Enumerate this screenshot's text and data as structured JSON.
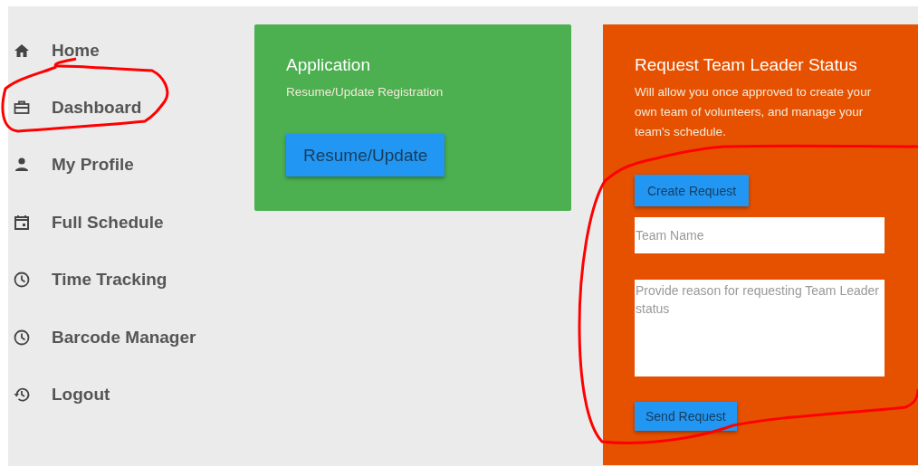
{
  "sidebar": {
    "items": [
      {
        "label": "Home",
        "kind": "home",
        "selected": false
      },
      {
        "label": "Dashboard",
        "kind": "briefcase",
        "selected": false
      },
      {
        "label": "My Profile",
        "kind": "person",
        "selected": false
      },
      {
        "label": "Full Schedule",
        "kind": "calendar",
        "selected": false
      },
      {
        "label": "Time Tracking",
        "kind": "clock",
        "selected": false
      },
      {
        "label": "Barcode Manager",
        "kind": "clock",
        "selected": false
      },
      {
        "label": "Logout",
        "kind": "history",
        "selected": false
      }
    ]
  },
  "cards": [
    {
      "kind": "application",
      "title": "Application",
      "subtitle": "Resume/Update Registration",
      "button": "Resume/Update"
    },
    {
      "kind": "request",
      "title": "Request Team Leader Status",
      "description": "Will allow you once approved to create your own team of volunteers, and manage your team's schedule.",
      "button": "Create Request",
      "name_field": {
        "placeholder": "Team Name"
      },
      "reason_field": {
        "placeholder": "Provide reason for requesting Team Leader status"
      },
      "submit": "Send Request"
    }
  ]
}
